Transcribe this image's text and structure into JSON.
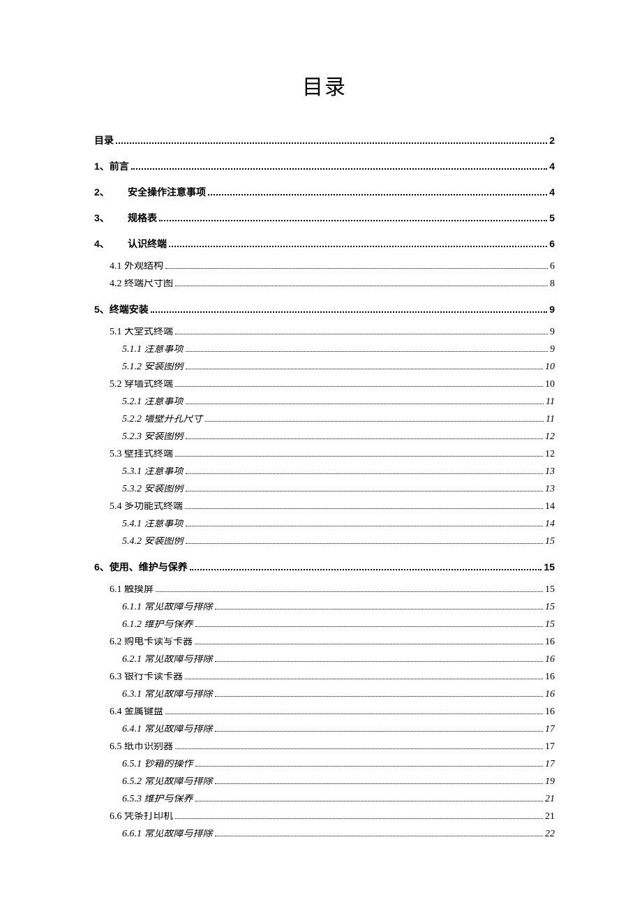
{
  "title": "目录",
  "toc": [
    {
      "level": 1,
      "label": "目录",
      "page": "2",
      "cls": ""
    },
    {
      "level": 1,
      "label": "1、前言",
      "page": "4",
      "cls": ""
    },
    {
      "level": 1,
      "label": "2、",
      "label2": "安全操作注意事项",
      "page": "4",
      "cls": "indent"
    },
    {
      "level": 1,
      "label": "3、",
      "label2": "规格表",
      "page": "5",
      "cls": "indent"
    },
    {
      "level": 1,
      "label": "4、",
      "label2": "认识终端",
      "page": "6",
      "cls": "indent"
    },
    {
      "level": 2,
      "label": "4.1 外观结构",
      "page": "6",
      "cls": "group-gap"
    },
    {
      "level": 2,
      "label": "4.2 终端尺寸图",
      "page": "8"
    },
    {
      "level": 1,
      "label": "5、终端安装",
      "page": "9",
      "cls": ""
    },
    {
      "level": 2,
      "label": "5.1 大堂式终端",
      "page": "9",
      "cls": "group-gap"
    },
    {
      "level": 3,
      "label": "5.1.1 注意事项",
      "page": "9"
    },
    {
      "level": 3,
      "label": "5.1.2 安装图例",
      "page": "10"
    },
    {
      "level": 2,
      "label": "5.2 穿墙式终端",
      "page": "10"
    },
    {
      "level": 3,
      "label": "5.2.1 注意事项",
      "page": "11"
    },
    {
      "level": 3,
      "label": "5.2.2 墙壁开孔尺寸",
      "page": "11"
    },
    {
      "level": 3,
      "label": "5.2.3 安装图例",
      "page": "12"
    },
    {
      "level": 2,
      "label": "5.3 壁挂式终端",
      "page": "12"
    },
    {
      "level": 3,
      "label": "5.3.1 注意事项",
      "page": "13"
    },
    {
      "level": 3,
      "label": "5.3.2 安装图例",
      "page": "13"
    },
    {
      "level": 2,
      "label": "5.4 多功能式终端",
      "page": "14"
    },
    {
      "level": 3,
      "label": "5.4.1 注意事项",
      "page": "14"
    },
    {
      "level": 3,
      "label": "5.4.2 安装图例",
      "page": "15"
    },
    {
      "level": 1,
      "label": "6、使用、维护与保养",
      "page": "15",
      "cls": ""
    },
    {
      "level": 2,
      "label": "6.1 触摸屏",
      "page": "15",
      "cls": "group-gap"
    },
    {
      "level": 3,
      "label": "6.1.1 常见故障与排除",
      "page": "15"
    },
    {
      "level": 3,
      "label": "6.1.2 维护与保养",
      "page": "15"
    },
    {
      "level": 2,
      "label": "6.2 购电卡读写卡器",
      "page": "16"
    },
    {
      "level": 3,
      "label": "6.2.1 常见故障与排除",
      "page": "16"
    },
    {
      "level": 2,
      "label": "6.3 银行卡读卡器",
      "page": "16"
    },
    {
      "level": 3,
      "label": "6.3.1 常见故障与排除",
      "page": "16"
    },
    {
      "level": 2,
      "label": "6.4 金属键盘",
      "page": "16"
    },
    {
      "level": 3,
      "label": "6.4.1 常见故障与排除",
      "page": "17"
    },
    {
      "level": 2,
      "label": "6.5 纸币识别器",
      "page": "17"
    },
    {
      "level": 3,
      "label": "6.5.1 钞箱的操作",
      "page": "17"
    },
    {
      "level": 3,
      "label": "6.5.2 常见故障与排除",
      "page": "19"
    },
    {
      "level": 3,
      "label": "6.5.3 维护与保养",
      "page": "21"
    },
    {
      "level": 2,
      "label": "6.6 凭条打印机",
      "page": "21"
    },
    {
      "level": 3,
      "label": "6.6.1 常见故障与排除",
      "page": "22"
    }
  ]
}
